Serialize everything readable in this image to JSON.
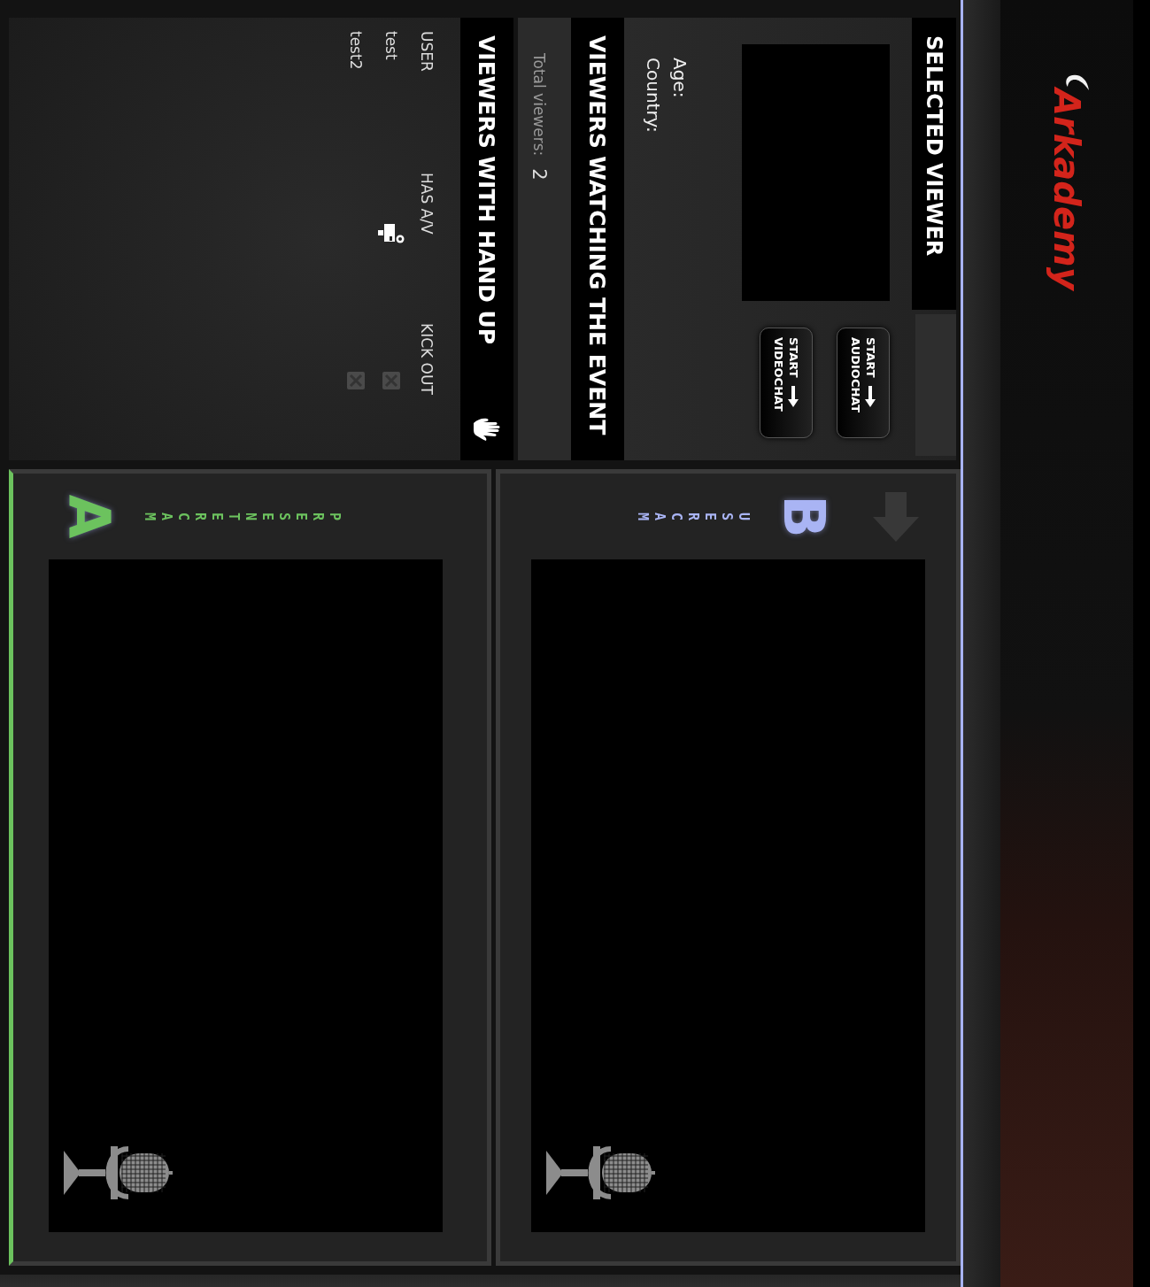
{
  "header": {
    "logo": "Arkademy"
  },
  "selected_viewer": {
    "title": "SELECTED VIEWER",
    "buttons": [
      {
        "top": "START",
        "bottom": "AUDIOCHAT"
      },
      {
        "top": "START",
        "bottom": "VIDEOCHAT"
      }
    ],
    "fields": [
      "Age:",
      "Country:"
    ]
  },
  "viewers": {
    "title": "VIEWERS WATCHING THE EVENT",
    "total_label": "Total viewers:",
    "total": "2"
  },
  "hand_up": {
    "title": "VIEWERS WITH HAND UP",
    "columns": [
      "USER",
      "HAS A/V",
      "KICK OUT"
    ],
    "rows": [
      {
        "user": "test",
        "has_av": true
      },
      {
        "user": "test2",
        "has_av": false
      }
    ]
  },
  "cams": [
    {
      "kind": "user",
      "letter": "B",
      "label": "USER CAM",
      "color": "#a9b4f4"
    },
    {
      "kind": "presenter",
      "letter": "A",
      "label": "PRESENTER CAM",
      "color": "#6cc25e"
    }
  ]
}
